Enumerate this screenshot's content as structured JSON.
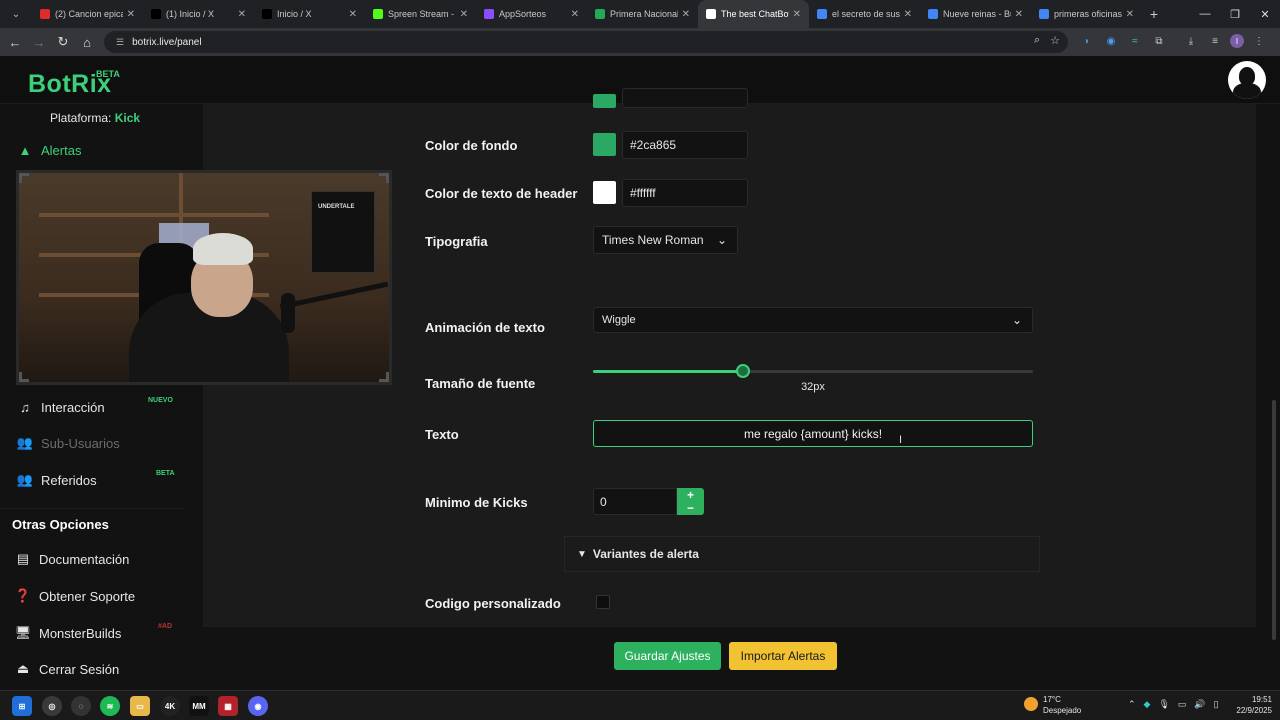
{
  "browser": {
    "tabs": [
      {
        "title": "(2) Cancion epica",
        "color": "#e02b2b"
      },
      {
        "title": "(1) Inicio / X",
        "color": "#000000"
      },
      {
        "title": "Inicio / X",
        "color": "#000000"
      },
      {
        "title": "Spreen Stream - V",
        "color": "#53fc18"
      },
      {
        "title": "AppSorteos",
        "color": "#8a4dff"
      },
      {
        "title": "Primera Nacional",
        "color": "#22aa55"
      },
      {
        "title": "The best ChatBot",
        "color": "#ffffff"
      },
      {
        "title": "el secreto de sus",
        "color": "#4285f4"
      },
      {
        "title": "Nueve reinas - Bu",
        "color": "#4285f4"
      },
      {
        "title": "primeras oficinas",
        "color": "#4285f4"
      }
    ],
    "active_tab": 6,
    "url": "botrix.live/panel",
    "profile_letter": "I"
  },
  "site": {
    "logo": "BotRix",
    "logo_badge": "BETA"
  },
  "sidebar": {
    "platform_label": "Plataforma:",
    "platform_value": "Kick",
    "alerts": "Alertas",
    "interaction": "Interacción",
    "interaction_badge": "NUEVO",
    "subusers": "Sub-Usuarios",
    "referrals": "Referidos",
    "referrals_badge": "BETA",
    "other_options": "Otras Opciones",
    "docs": "Documentación",
    "support": "Obtener Soporte",
    "monsterbuilds": "MonsterBuilds",
    "monsterbuilds_badge": "#AD",
    "logout": "Cerrar Sesión"
  },
  "webcam": {
    "poster_text": "UNDERTALE"
  },
  "form": {
    "bg_color_label": "Color de fondo",
    "bg_color_value": "#2ca865",
    "header_text_color_label": "Color de texto de header",
    "header_text_color_value": "#ffffff",
    "typography_label": "Tipografia",
    "typography_value": "Times New Roman",
    "text_animation_label": "Animación de texto",
    "text_animation_value": "Wiggle",
    "font_size_label": "Tamaño de fuente",
    "font_size_value": "32px",
    "font_size_fraction": 0.34,
    "text_label": "Texto",
    "text_value": "me regalo {amount} kicks!",
    "min_kicks_label": "Minimo de Kicks",
    "min_kicks_value": "0",
    "variants_label": "Variantes de alerta",
    "custom_code_label": "Codigo personalizado"
  },
  "buttons": {
    "save": "Guardar Ajustes",
    "import": "Importar Alertas"
  },
  "taskbar": {
    "temperature": "17°C",
    "weather": "Despejado",
    "time": "19:51",
    "date": "22/9/2025"
  },
  "colors": {
    "accent": "#3dd07a",
    "swatch_bg": "#2ca865",
    "swatch_header_text": "#ffffff",
    "import_button": "#f1c232"
  }
}
